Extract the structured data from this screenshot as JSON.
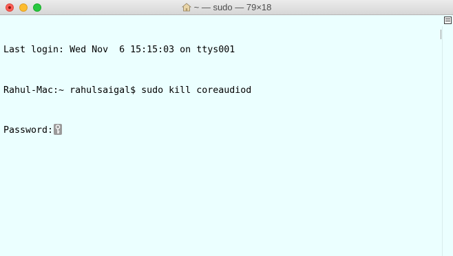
{
  "window": {
    "title": "~ — sudo — 79×18",
    "home_icon": "home-folder-icon",
    "controls": [
      "close-button",
      "minimize-button",
      "zoom-button"
    ],
    "colors": {
      "background": "#ebffff",
      "text": "#000000",
      "close": "#fc5f57",
      "minimize": "#fdbc2e",
      "zoom": "#28c840"
    }
  },
  "terminal": {
    "lines": [
      "Last login: Wed Nov  6 15:15:03 on ttys001",
      "Rahul-Mac:~ rahulsaigal$ sudo kill coreaudiod",
      "Password:"
    ],
    "cursor_icon": "key-icon"
  }
}
